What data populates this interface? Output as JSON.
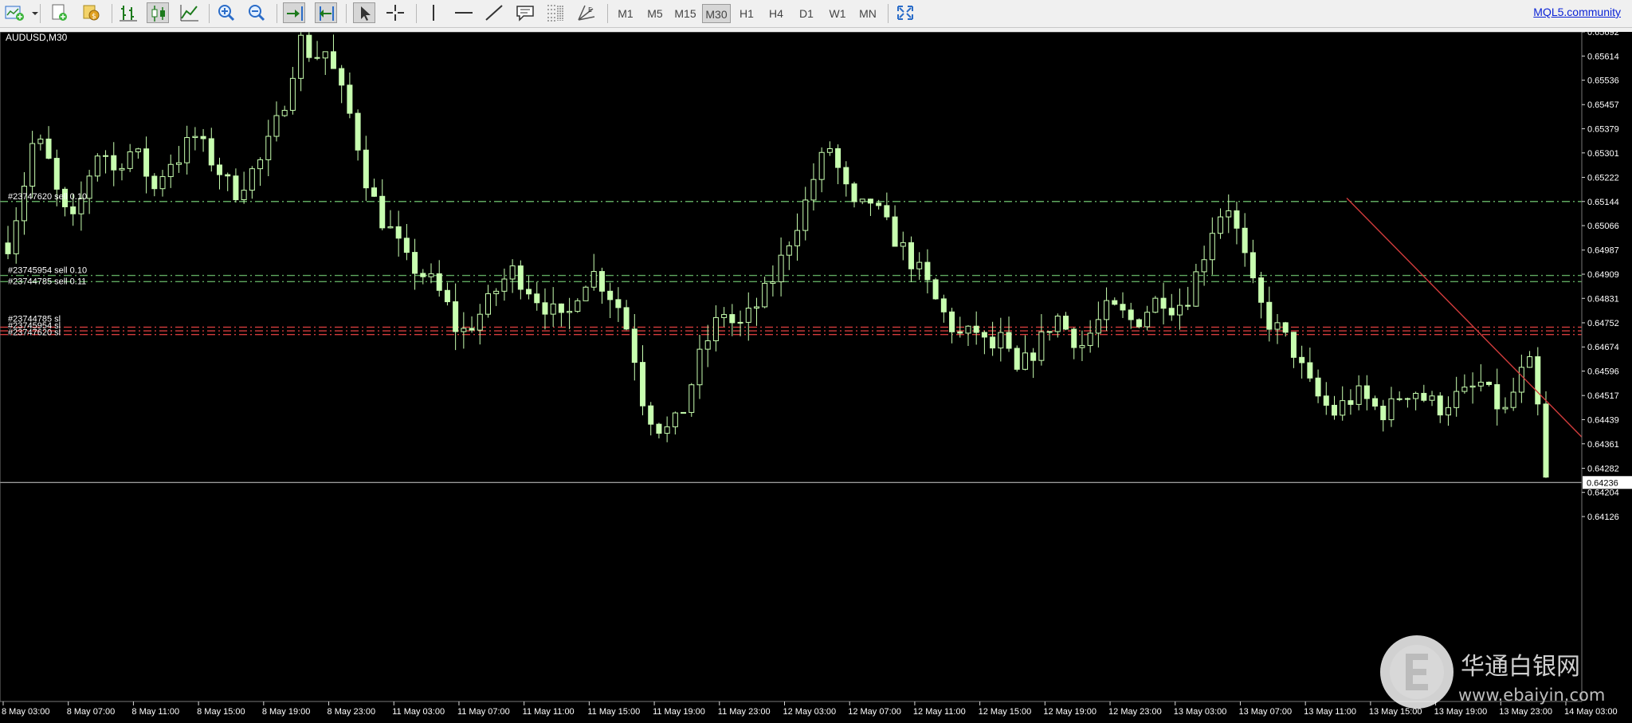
{
  "toolbar": {
    "icons": [
      "new-chart-icon",
      "profiles-dropdown-icon",
      "new-order-icon",
      "market-watch-icon",
      "bar-chart-icon",
      "candlestick-chart-icon",
      "line-chart-icon",
      "zoom-in-icon",
      "zoom-out-icon",
      "auto-scroll-icon",
      "chart-shift-icon",
      "cursor-icon",
      "crosshair-icon",
      "vertical-line-icon",
      "horizontal-line-icon",
      "trendline-icon",
      "text-label-icon",
      "fibonacci-icon",
      "gann-icon",
      "fullscreen-icon"
    ],
    "timeframes": [
      "M1",
      "M5",
      "M15",
      "M30",
      "H1",
      "H4",
      "D1",
      "W1",
      "MN"
    ],
    "active_timeframe": "M30",
    "link_label": "MQL5.community"
  },
  "chart_data": {
    "type": "candlestick",
    "title": "AUDUSD,M30",
    "background": "#000000",
    "candle_color": "#c8ffb0",
    "grid": false,
    "y_ticks": [
      "0.65692",
      "0.65614",
      "0.65536",
      "0.65457",
      "0.65379",
      "0.65301",
      "0.65222",
      "0.65144",
      "0.65066",
      "0.64987",
      "0.64909",
      "0.64831",
      "0.64752",
      "0.64674",
      "0.64596",
      "0.64517",
      "0.64439",
      "0.64361",
      "0.64282",
      "0.64204",
      "0.64126"
    ],
    "ylim": [
      0.6411,
      0.6571
    ],
    "x_ticks": [
      "8 May 03:00",
      "8 May 07:00",
      "8 May 11:00",
      "8 May 15:00",
      "8 May 19:00",
      "8 May 23:00",
      "11 May 03:00",
      "11 May 07:00",
      "11 May 11:00",
      "11 May 15:00",
      "11 May 19:00",
      "11 May 23:00",
      "12 May 03:00",
      "12 May 07:00",
      "12 May 11:00",
      "12 May 15:00",
      "12 May 19:00",
      "12 May 23:00",
      "13 May 03:00",
      "13 May 07:00",
      "13 May 11:00",
      "13 May 15:00",
      "13 May 19:00",
      "13 May 23:00",
      "14 May 03:00"
    ],
    "bid_price": "0.64236",
    "bid_value": 0.64236,
    "close_path": [
      0.6501,
      0.6516,
      0.6536,
      0.6528,
      0.6512,
      0.6507,
      0.6522,
      0.6533,
      0.6524,
      0.6531,
      0.6528,
      0.6518,
      0.6527,
      0.6529,
      0.6536,
      0.653,
      0.6524,
      0.6517,
      0.6522,
      0.6527,
      0.6536,
      0.6549,
      0.6567,
      0.6561,
      0.6563,
      0.6551,
      0.654,
      0.6522,
      0.651,
      0.6504,
      0.6495,
      0.6492,
      0.6488,
      0.6482,
      0.6471,
      0.6475,
      0.648,
      0.6487,
      0.6492,
      0.6488,
      0.6483,
      0.6479,
      0.6474,
      0.6486,
      0.6492,
      0.6487,
      0.6481,
      0.647,
      0.6448,
      0.6442,
      0.644,
      0.6448,
      0.6462,
      0.6472,
      0.6479,
      0.6473,
      0.6478,
      0.6484,
      0.6492,
      0.6503,
      0.6512,
      0.6525,
      0.6532,
      0.652,
      0.651,
      0.6515,
      0.6508,
      0.6502,
      0.6496,
      0.649,
      0.6482,
      0.6475,
      0.647,
      0.6473,
      0.6466,
      0.647,
      0.6458,
      0.6464,
      0.647,
      0.6478,
      0.6472,
      0.6468,
      0.6474,
      0.648,
      0.6478,
      0.6475,
      0.648,
      0.6484,
      0.648,
      0.6484,
      0.6495,
      0.6508,
      0.6514,
      0.65,
      0.6485,
      0.6476,
      0.6472,
      0.6466,
      0.6456,
      0.645,
      0.6446,
      0.645,
      0.6452,
      0.6448,
      0.6446,
      0.6452,
      0.6454,
      0.645,
      0.6448,
      0.6451,
      0.6452,
      0.6456,
      0.645,
      0.6446,
      0.6458,
      0.6462,
      0.6424
    ],
    "levels": [
      {
        "label": "#23747620 sell 0.10",
        "value": 0.65144,
        "color": "#5fa85f"
      },
      {
        "label": "#23745954 sell 0.10",
        "value": 0.64905,
        "color": "#5fa85f"
      },
      {
        "label": "#23744785 sell 0.11",
        "value": 0.64885,
        "color": "#5fa85f"
      },
      {
        "label": "#23744785 sl",
        "value": 0.64738,
        "color": "#d23c3c"
      },
      {
        "label": "#23745954 sl",
        "value": 0.64726,
        "color": "#d23c3c"
      },
      {
        "label": "#23747620 sl",
        "value": 0.64714,
        "color": "#d23c3c"
      }
    ],
    "trendline": {
      "color": "#d23c3c"
    }
  },
  "watermark": {
    "cn_text": "华通白银网",
    "url_text": "www.ebaiyin.com"
  }
}
